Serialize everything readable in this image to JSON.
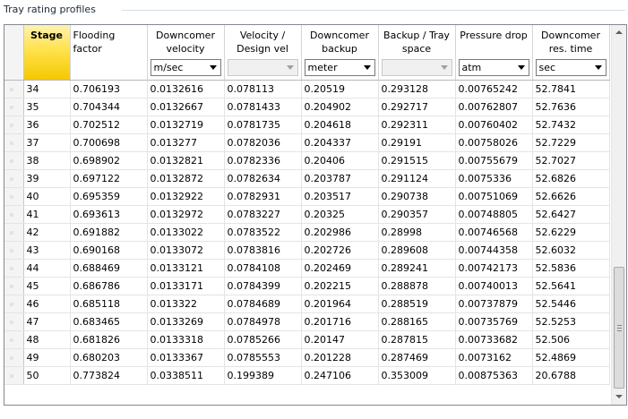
{
  "panel": {
    "title": "Tray rating profiles"
  },
  "columns": [
    {
      "label": "Stage",
      "unit": null
    },
    {
      "label": "Flooding factor",
      "unit": null
    },
    {
      "label": "Downcomer velocity",
      "unit": "m/sec"
    },
    {
      "label": "Velocity / Design vel",
      "unit": ""
    },
    {
      "label": "Downcomer backup",
      "unit": "meter"
    },
    {
      "label": "Backup / Tray space",
      "unit": ""
    },
    {
      "label": "Pressure drop",
      "unit": "atm"
    },
    {
      "label": "Downcomer res. time",
      "unit": "sec"
    }
  ],
  "rows": [
    [
      "34",
      "0.706193",
      "0.0132616",
      "0.078113",
      "0.20519",
      "0.293128",
      "0.00765242",
      "52.7841"
    ],
    [
      "35",
      "0.704344",
      "0.0132667",
      "0.0781433",
      "0.204902",
      "0.292717",
      "0.00762807",
      "52.7636"
    ],
    [
      "36",
      "0.702512",
      "0.0132719",
      "0.0781735",
      "0.204618",
      "0.292311",
      "0.00760402",
      "52.7432"
    ],
    [
      "37",
      "0.700698",
      "0.013277",
      "0.0782036",
      "0.204337",
      "0.29191",
      "0.00758026",
      "52.7229"
    ],
    [
      "38",
      "0.698902",
      "0.0132821",
      "0.0782336",
      "0.20406",
      "0.291515",
      "0.00755679",
      "52.7027"
    ],
    [
      "39",
      "0.697122",
      "0.0132872",
      "0.0782634",
      "0.203787",
      "0.291124",
      "0.0075336",
      "52.6826"
    ],
    [
      "40",
      "0.695359",
      "0.0132922",
      "0.0782931",
      "0.203517",
      "0.290738",
      "0.00751069",
      "52.6626"
    ],
    [
      "41",
      "0.693613",
      "0.0132972",
      "0.0783227",
      "0.20325",
      "0.290357",
      "0.00748805",
      "52.6427"
    ],
    [
      "42",
      "0.691882",
      "0.0133022",
      "0.0783522",
      "0.202986",
      "0.28998",
      "0.00746568",
      "52.6229"
    ],
    [
      "43",
      "0.690168",
      "0.0133072",
      "0.0783816",
      "0.202726",
      "0.289608",
      "0.00744358",
      "52.6032"
    ],
    [
      "44",
      "0.688469",
      "0.0133121",
      "0.0784108",
      "0.202469",
      "0.289241",
      "0.00742173",
      "52.5836"
    ],
    [
      "45",
      "0.686786",
      "0.0133171",
      "0.0784399",
      "0.202215",
      "0.288878",
      "0.00740013",
      "52.5641"
    ],
    [
      "46",
      "0.685118",
      "0.013322",
      "0.0784689",
      "0.201964",
      "0.288519",
      "0.00737879",
      "52.5446"
    ],
    [
      "47",
      "0.683465",
      "0.0133269",
      "0.0784978",
      "0.201716",
      "0.288165",
      "0.00735769",
      "52.5253"
    ],
    [
      "48",
      "0.681826",
      "0.0133318",
      "0.0785266",
      "0.20147",
      "0.287815",
      "0.00733682",
      "52.506"
    ],
    [
      "49",
      "0.680203",
      "0.0133367",
      "0.0785553",
      "0.201228",
      "0.287469",
      "0.0073162",
      "52.4869"
    ],
    [
      "50",
      "0.773824",
      "0.0338511",
      "0.199389",
      "0.247106",
      "0.353009",
      "0.00875363",
      "20.6788"
    ]
  ],
  "colors": {
    "stage_header": "#ffe24d",
    "grid_border": "#828790"
  }
}
